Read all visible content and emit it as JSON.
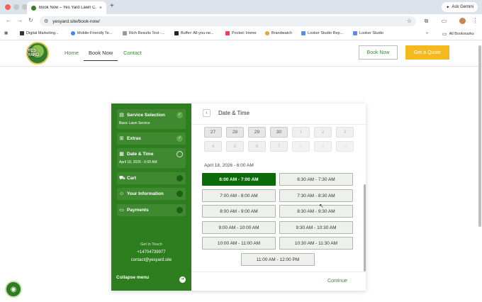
{
  "browser": {
    "tab_title": "Book Now – Yes Yard Lawn C…",
    "tab_close": "×",
    "new_tab": "+",
    "url": "yesyard.site/book-now/",
    "ask_gemini": "Ask Gemini",
    "bookmarks": [
      "Digital Marketing...",
      "Mobile-Friendly Te...",
      "Rich Results Test -...",
      "Buffer: All-you-ne...",
      "Pocket: Home",
      "Brandwatch",
      "Looker Studio Rep...",
      "Looker Studio"
    ],
    "all_bookmarks": "All Bookmarks",
    "more_bookmarks": "»"
  },
  "site": {
    "logo_text": "YES YARD",
    "nav": [
      "Home",
      "Book Now",
      "Contact"
    ],
    "book_now_button": "Book Now",
    "quote_button": "Get a Quote"
  },
  "sidebar": {
    "steps": [
      {
        "label": "Service Selection",
        "sub": "Basic Lawn Service",
        "status": "done",
        "icon": "service-icon"
      },
      {
        "label": "Extras",
        "sub": "",
        "status": "done",
        "icon": "extras-icon"
      },
      {
        "label": "Date & Time",
        "sub": "April 18, 2026 - 6:00 AM",
        "status": "current",
        "icon": "calendar-icon"
      },
      {
        "label": "Cart",
        "sub": "",
        "status": "pending",
        "icon": "cart-icon"
      },
      {
        "label": "Your Information",
        "sub": "",
        "status": "pending",
        "icon": "user-icon"
      },
      {
        "label": "Payments",
        "sub": "",
        "status": "pending",
        "icon": "payment-icon"
      }
    ],
    "get_in_touch": "Get in Touch",
    "phone": "+14704739977",
    "email": "contact@yesyard.site",
    "collapse": "Collapse menu"
  },
  "content": {
    "title": "Date & Time",
    "calendar_row1": [
      "27",
      "28",
      "29",
      "30",
      "1",
      "2",
      "3"
    ],
    "calendar_row2": [
      "4",
      "5",
      "6",
      "7",
      "8",
      "9",
      "10"
    ],
    "selected_date": "April 18, 2026 - 6:00 AM",
    "slots": [
      "6:00 AM - 7:00 AM",
      "6:30 AM - 7:30 AM",
      "7:00 AM - 8:00 AM",
      "7:30 AM - 8:30 AM",
      "8:00 AM - 9:00 AM",
      "8:30 AM - 9:30 AM",
      "9:00 AM - 10:00 AM",
      "9:30 AM - 10:30 AM",
      "10:00 AM - 11:00 AM",
      "10:30 AM - 11:30 AM",
      "11:00 AM - 12:00 PM"
    ],
    "selected_slot": "6:00 AM - 7:00 AM",
    "continue": "Continue"
  },
  "colors": {
    "brand_green": "#2e7d1e",
    "selected_slot": "#0b6b0b",
    "quote_yellow": "#f5b920"
  }
}
